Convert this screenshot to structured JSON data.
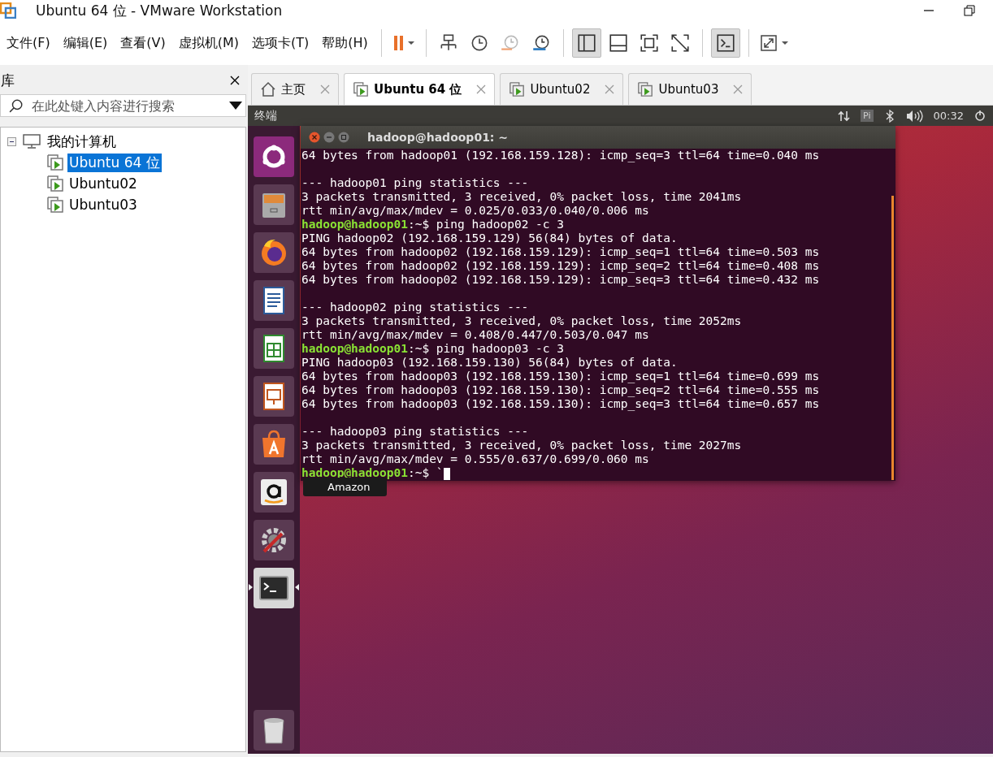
{
  "window": {
    "title": "Ubuntu 64 位 - VMware Workstation"
  },
  "menu": [
    "文件(F)",
    "编辑(E)",
    "查看(V)",
    "虚拟机(M)",
    "选项卡(T)",
    "帮助(H)"
  ],
  "library": {
    "title": "库",
    "search": {
      "placeholder": "在此处键入内容进行搜索"
    },
    "tree": [
      {
        "label": "我的计算机",
        "expanded": true,
        "children": [
          {
            "label": "Ubuntu 64 位",
            "selected": true
          },
          {
            "label": "Ubuntu02",
            "selected": false
          },
          {
            "label": "Ubuntu03",
            "selected": false
          }
        ]
      }
    ]
  },
  "tabs": [
    {
      "label": "主页",
      "kind": "home",
      "selected": false
    },
    {
      "label": "Ubuntu 64 位",
      "kind": "vm",
      "selected": true
    },
    {
      "label": "Ubuntu02",
      "kind": "vm",
      "selected": false
    },
    {
      "label": "Ubuntu03",
      "kind": "vm",
      "selected": false
    }
  ],
  "vm": {
    "top_bar": {
      "app_title": "终端",
      "keyboard": "Pi",
      "time": "00:32"
    },
    "launcher": [
      {
        "kind": "ubuntu",
        "active": false
      },
      {
        "kind": "files",
        "active": false
      },
      {
        "kind": "firefox",
        "active": false
      },
      {
        "kind": "writer",
        "active": false
      },
      {
        "kind": "calc",
        "active": false
      },
      {
        "kind": "impress",
        "active": false
      },
      {
        "kind": "software",
        "active": false
      },
      {
        "kind": "amazon",
        "active": false,
        "tooltip": "Amazon"
      },
      {
        "kind": "settings",
        "active": false
      },
      {
        "kind": "terminal",
        "active": true
      }
    ],
    "trash": {
      "kind": "trash"
    },
    "terminal": {
      "title": "hadoop@hadoop01: ~",
      "lines": [
        {
          "kind": "output",
          "text": "64 bytes from hadoop01 (192.168.159.128): icmp_seq=3 ttl=64 time=0.040 ms"
        },
        {
          "kind": "blank"
        },
        {
          "kind": "output",
          "text": "--- hadoop01 ping statistics ---"
        },
        {
          "kind": "output",
          "text": "3 packets transmitted, 3 received, 0% packet loss, time 2041ms"
        },
        {
          "kind": "output",
          "text": "rtt min/avg/max/mdev = 0.025/0.033/0.040/0.006 ms"
        },
        {
          "kind": "prompt",
          "user": "hadoop@hadoop01",
          "text": ":~$ ping hadoop02 -c 3",
          "cursor": false
        },
        {
          "kind": "output",
          "text": "PING hadoop02 (192.168.159.129) 56(84) bytes of data."
        },
        {
          "kind": "output",
          "text": "64 bytes from hadoop02 (192.168.159.129): icmp_seq=1 ttl=64 time=0.503 ms"
        },
        {
          "kind": "output",
          "text": "64 bytes from hadoop02 (192.168.159.129): icmp_seq=2 ttl=64 time=0.408 ms"
        },
        {
          "kind": "output",
          "text": "64 bytes from hadoop02 (192.168.159.129): icmp_seq=3 ttl=64 time=0.432 ms"
        },
        {
          "kind": "blank"
        },
        {
          "kind": "output",
          "text": "--- hadoop02 ping statistics ---"
        },
        {
          "kind": "output",
          "text": "3 packets transmitted, 3 received, 0% packet loss, time 2052ms"
        },
        {
          "kind": "output",
          "text": "rtt min/avg/max/mdev = 0.408/0.447/0.503/0.047 ms"
        },
        {
          "kind": "prompt",
          "user": "hadoop@hadoop01",
          "text": ":~$ ping hadoop03 -c 3",
          "cursor": false
        },
        {
          "kind": "output",
          "text": "PING hadoop03 (192.168.159.130) 56(84) bytes of data."
        },
        {
          "kind": "output",
          "text": "64 bytes from hadoop03 (192.168.159.130): icmp_seq=1 ttl=64 time=0.699 ms"
        },
        {
          "kind": "output",
          "text": "64 bytes from hadoop03 (192.168.159.130): icmp_seq=2 ttl=64 time=0.555 ms"
        },
        {
          "kind": "output",
          "text": "64 bytes from hadoop03 (192.168.159.130): icmp_seq=3 ttl=64 time=0.657 ms"
        },
        {
          "kind": "blank"
        },
        {
          "kind": "output",
          "text": "--- hadoop03 ping statistics ---"
        },
        {
          "kind": "output",
          "text": "3 packets transmitted, 3 received, 0% packet loss, time 2027ms"
        },
        {
          "kind": "output",
          "text": "rtt min/avg/max/mdev = 0.555/0.637/0.699/0.060 ms"
        },
        {
          "kind": "prompt",
          "user": "hadoop@hadoop01",
          "text": ":~$ `",
          "cursor": true
        }
      ]
    }
  }
}
